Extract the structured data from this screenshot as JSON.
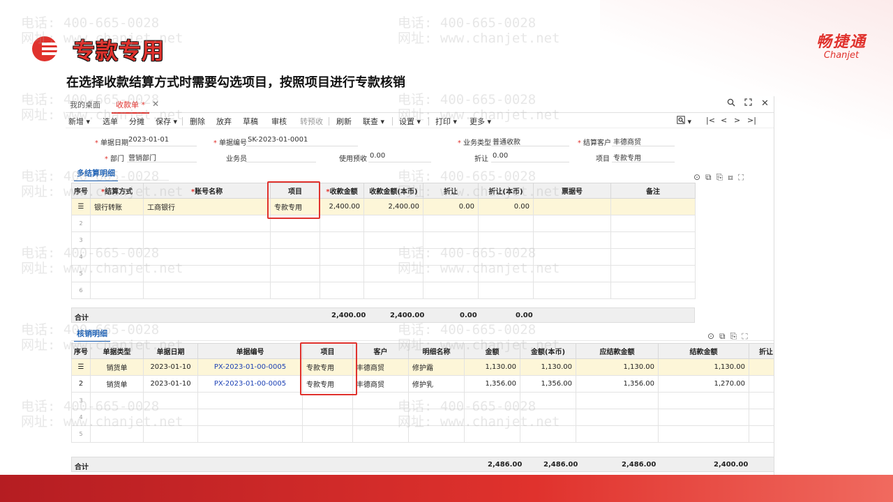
{
  "slide": {
    "title": "专款专用",
    "subtitle": "在选择收款结算方式时需要勾选项目，按照项目进行专款核销",
    "brand_cn": "畅捷通",
    "brand_en": "Chanjet",
    "watermark_phone": "电话: 400-665-0028",
    "watermark_site": "网址: www.chanjet.net",
    "accent_color": "#e0322d"
  },
  "window": {
    "tabs": [
      "我的桌面",
      "收款单 *"
    ],
    "controls": [
      "search-icon",
      "maximize-icon",
      "close-icon"
    ]
  },
  "toolbar": {
    "buttons": [
      "新增",
      "选单",
      "分摊",
      "保存",
      "删除",
      "放弃",
      "草稿",
      "审核",
      "转预收",
      "刷新",
      "联查",
      "设置",
      "打印",
      "更多"
    ]
  },
  "form": {
    "date_label": "单据日期",
    "date_value": "2023-01-01",
    "no_label": "单据编号",
    "no_value": "SK-2023-01-0001",
    "biztype_label": "业务类型",
    "biztype_value": "普通收款",
    "customer_label": "结算客户",
    "customer_value": "丰德商贸",
    "dept_label": "部门",
    "dept_value": "营销部门",
    "staff_label": "业务员",
    "staff_value": "",
    "prepay_label": "使用预收",
    "prepay_value": "0.00",
    "discount_label": "折让",
    "discount_value": "0.00",
    "project_label": "项目",
    "project_value": "专款专用"
  },
  "settlement": {
    "section_title": "多结算明细",
    "headers": [
      "序号",
      "结算方式",
      "账号名称",
      "项目",
      "收款金额",
      "收款金额(本币)",
      "折让",
      "折让(本币)",
      "票据号",
      "备注"
    ],
    "rows": [
      {
        "no": "",
        "method": "银行转账",
        "account": "工商银行",
        "project": "专款专用",
        "amount": "2,400.00",
        "amount_local": "2,400.00",
        "discount": "0.00",
        "discount_local": "0.00",
        "bill": "",
        "note": ""
      }
    ],
    "empty_rows": [
      "2",
      "3",
      "4",
      "5",
      "6"
    ],
    "total_label": "合计",
    "total_amount": "2,400.00",
    "total_amount_local": "2,400.00",
    "total_discount": "0.00",
    "total_discount_local": "0.00"
  },
  "writeoff": {
    "section_title": "核销明细",
    "headers": [
      "序号",
      "单据类型",
      "单据日期",
      "单据编号",
      "项目",
      "客户",
      "明细名称",
      "金额",
      "金额(本币)",
      "应结款金额",
      "结款金额",
      "折让"
    ],
    "rows": [
      {
        "no": "",
        "type": "销货单",
        "date": "2023-01-10",
        "code": "PX-2023-01-00-0005",
        "project": "专款专用",
        "customer": "丰德商贸",
        "item": "修护霜",
        "amount": "1,130.00",
        "amount_local": "1,130.00",
        "due": "1,130.00",
        "settled": "1,130.00"
      },
      {
        "no": "2",
        "type": "销货单",
        "date": "2023-01-10",
        "code": "PX-2023-01-00-0005",
        "project": "专款专用",
        "customer": "丰德商贸",
        "item": "修护乳",
        "amount": "1,356.00",
        "amount_local": "1,356.00",
        "due": "1,356.00",
        "settled": "1,270.00"
      }
    ],
    "empty_rows": [
      "3",
      "4",
      "5"
    ],
    "total_label": "合计",
    "total_amount": "2,486.00",
    "total_amount_local": "2,486.00",
    "total_due": "2,486.00",
    "total_settled": "2,400.00"
  }
}
